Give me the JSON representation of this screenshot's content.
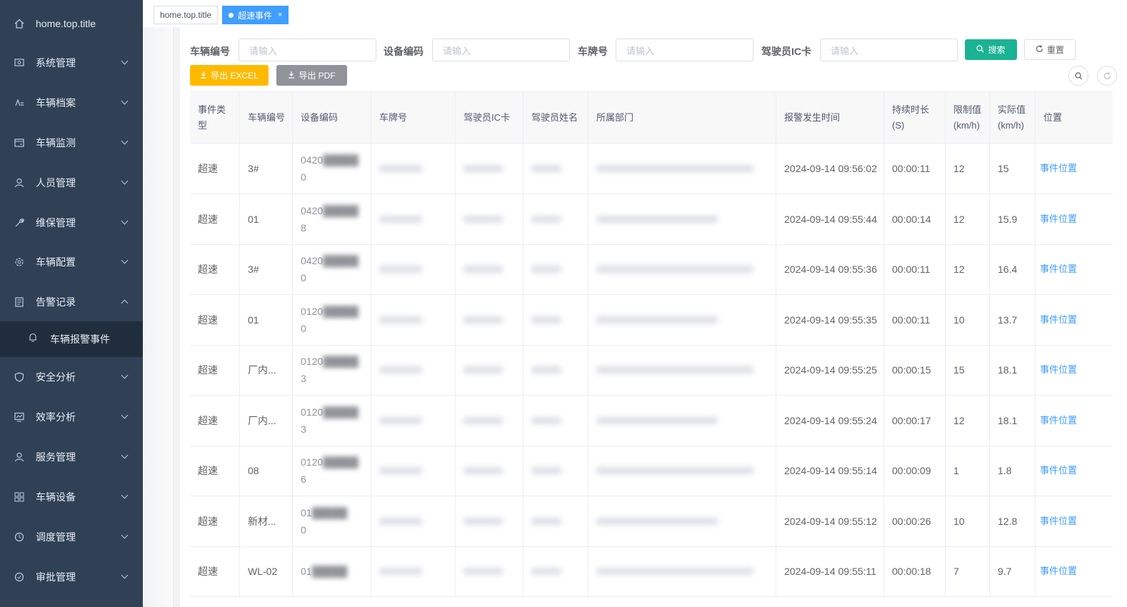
{
  "sidebar": {
    "home": "home.top.title",
    "items": [
      {
        "label": "系统管理",
        "icon": "system-icon"
      },
      {
        "label": "车辆档案",
        "icon": "vehicle-archive-icon"
      },
      {
        "label": "车辆监测",
        "icon": "monitor-icon"
      },
      {
        "label": "人员管理",
        "icon": "person-icon"
      },
      {
        "label": "维保管理",
        "icon": "wrench-icon"
      },
      {
        "label": "车辆配置",
        "icon": "config-icon"
      },
      {
        "label": "告警记录",
        "icon": "alarm-record-icon"
      },
      {
        "label": "安全分析",
        "icon": "shield-icon"
      },
      {
        "label": "效率分析",
        "icon": "efficiency-icon"
      },
      {
        "label": "服务管理",
        "icon": "service-icon"
      },
      {
        "label": "车辆设备",
        "icon": "device-grid-icon"
      },
      {
        "label": "调度管理",
        "icon": "dispatch-icon"
      },
      {
        "label": "审批管理",
        "icon": "approval-icon"
      }
    ],
    "submenu_active": "车辆报警事件"
  },
  "tags": {
    "home": "home.top.title",
    "active": "超速事件",
    "close": "×"
  },
  "search": {
    "vehicle_no_label": "车辆编号",
    "device_code_label": "设备编码",
    "plate_label": "车牌号",
    "driver_ic_label": "驾驶员IC卡",
    "placeholder": "请输入",
    "search_button": "搜索",
    "reset_button": "重置",
    "export_excel": "导出 EXCEL",
    "export_pdf": "导出 PDF"
  },
  "table": {
    "headers": {
      "event_type_1": "事件类",
      "event_type_2": "型",
      "vehicle_no": "车辆编号",
      "device_code": "设备编码",
      "plate": "车牌号",
      "driver_ic": "驾驶员IC卡",
      "driver_name": "驾驶员姓名",
      "department": "所属部门",
      "alarm_time": "报警发生时间",
      "duration_1": "持续时长",
      "duration_2": "(S)",
      "limit_1": "限制值",
      "limit_2": "(km/h)",
      "actual_1": "实际值",
      "actual_2": "(km/h)",
      "position": "位置"
    },
    "rows": [
      {
        "type": "超速",
        "vehicle": "3#",
        "dev_a": "0420",
        "dev_b": "0",
        "time": "2024-09-14 09:56:02",
        "duration": "00:00:11",
        "limit": "12",
        "actual": "15",
        "link": "事件位置"
      },
      {
        "type": "超速",
        "vehicle": "01",
        "dev_a": "0420",
        "dev_b": "8",
        "time": "2024-09-14 09:55:44",
        "duration": "00:00:14",
        "limit": "12",
        "actual": "15.9",
        "link": "事件位置"
      },
      {
        "type": "超速",
        "vehicle": "3#",
        "dev_a": "0420",
        "dev_b": "0",
        "time": "2024-09-14 09:55:36",
        "duration": "00:00:11",
        "limit": "12",
        "actual": "16.4",
        "link": "事件位置"
      },
      {
        "type": "超速",
        "vehicle": "01",
        "dev_a": "0120",
        "dev_b": "0",
        "time": "2024-09-14 09:55:35",
        "duration": "00:00:11",
        "limit": "10",
        "actual": "13.7",
        "link": "事件位置"
      },
      {
        "type": "超速",
        "vehicle": "厂内...",
        "dev_a": "0120",
        "dev_b": "3",
        "time": "2024-09-14 09:55:25",
        "duration": "00:00:15",
        "limit": "15",
        "actual": "18.1",
        "link": "事件位置"
      },
      {
        "type": "超速",
        "vehicle": "厂内...",
        "dev_a": "0120",
        "dev_b": "3",
        "time": "2024-09-14 09:55:24",
        "duration": "00:00:17",
        "limit": "12",
        "actual": "18.1",
        "link": "事件位置"
      },
      {
        "type": "超速",
        "vehicle": "08",
        "dev_a": "0120",
        "dev_b": "6",
        "time": "2024-09-14 09:55:14",
        "duration": "00:00:09",
        "limit": "1",
        "actual": "1.8",
        "link": "事件位置"
      },
      {
        "type": "超速",
        "vehicle": "新材...",
        "dev_a": "01",
        "dev_b": "0",
        "time": "2024-09-14 09:55:12",
        "duration": "00:00:26",
        "limit": "10",
        "actual": "12.8",
        "link": "事件位置"
      },
      {
        "type": "超速",
        "vehicle": "WL-02",
        "dev_a": "01",
        "dev_b": "",
        "time": "2024-09-14 09:55:11",
        "duration": "00:00:18",
        "limit": "7",
        "actual": "9.7",
        "link": "事件位置"
      }
    ]
  },
  "colors": {
    "sidebar_bg": "#304156",
    "submenu_bg": "#1f2d3d",
    "primary": "#409eff",
    "search_btn": "#1ab394",
    "excel_btn": "#ffba00",
    "pdf_btn": "#909399"
  }
}
